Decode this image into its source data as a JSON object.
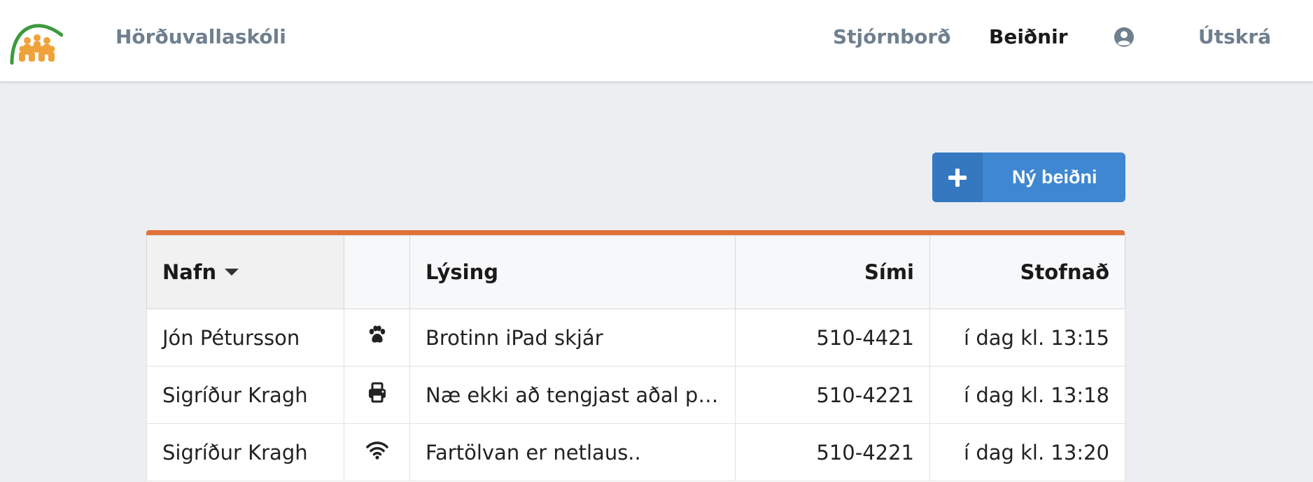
{
  "header": {
    "brand": "Hörðuvallaskóli",
    "nav": {
      "dashboard": "Stjórnborð",
      "requests": "Beiðnir",
      "logout": "Útskrá"
    }
  },
  "actions": {
    "new_request": "Ný beiðni"
  },
  "table": {
    "columns": {
      "name": "Nafn",
      "type": "",
      "description": "Lýsing",
      "phone": "Sími",
      "created": "Stofnað"
    },
    "rows": [
      {
        "name": "Jón Pétursson",
        "icon": "paw-icon",
        "description": "Brotinn iPad skjár",
        "phone": "510-4421",
        "created": "í dag kl. 13:15"
      },
      {
        "name": "Sigríður Kragh",
        "icon": "printer-icon",
        "description": "Næ ekki að tengjast aðal pre…",
        "phone": "510-4221",
        "created": "í dag kl. 13:18"
      },
      {
        "name": "Sigríður Kragh",
        "icon": "wifi-icon",
        "description": "Fartölvan er netlaus..",
        "phone": "510-4221",
        "created": "í dag kl. 13:20"
      }
    ]
  },
  "colors": {
    "accent": "#e07238",
    "button": "#3f87d0",
    "logo_arc": "#3d9a3e",
    "logo_people": "#f0a23a"
  }
}
